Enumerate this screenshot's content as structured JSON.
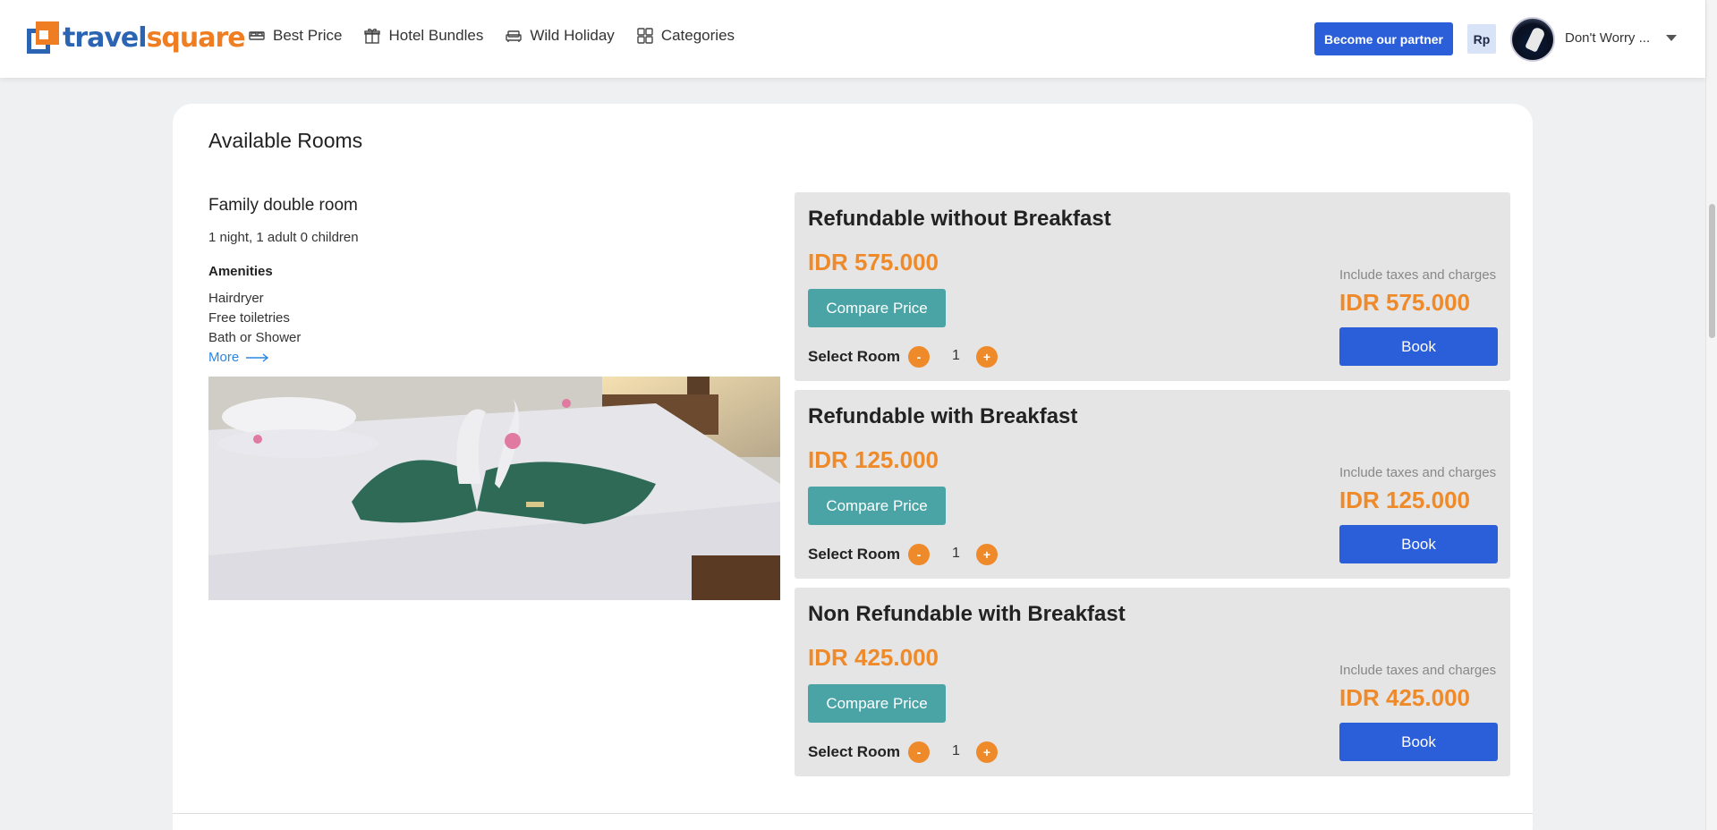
{
  "header": {
    "logo": {
      "part1": "travel",
      "part2": "square"
    },
    "nav": [
      {
        "label": "Best Price",
        "icon": "bed-icon"
      },
      {
        "label": "Hotel Bundles",
        "icon": "gift-icon"
      },
      {
        "label": "Wild Holiday",
        "icon": "sofa-icon"
      },
      {
        "label": "Categories",
        "icon": "grid-icon"
      }
    ],
    "partner_button": "Become our partner",
    "currency": "Rp",
    "user_name": "Don't Worry ..."
  },
  "section": {
    "title": "Available Rooms"
  },
  "room": {
    "name": "Family double room",
    "guests": "1 night, 1 adult 0 children",
    "amenities_title": "Amenities",
    "amenities": [
      "Hairdryer",
      "Free toiletries",
      "Bath or Shower"
    ],
    "more_label": "More"
  },
  "options": [
    {
      "title": "Refundable without Breakfast",
      "price": "IDR 575.000",
      "compare_label": "Compare Price",
      "select_label": "Select Room",
      "minus": "-",
      "quantity": "1",
      "plus": "+",
      "tax_note": "Include taxes and charges",
      "total": "IDR 575.000",
      "book_label": "Book"
    },
    {
      "title": "Refundable with Breakfast",
      "price": "IDR 125.000",
      "compare_label": "Compare Price",
      "select_label": "Select Room",
      "minus": "-",
      "quantity": "1",
      "plus": "+",
      "tax_note": "Include taxes and charges",
      "total": "IDR 125.000",
      "book_label": "Book"
    },
    {
      "title": "Non Refundable with Breakfast",
      "price": "IDR 425.000",
      "compare_label": "Compare Price",
      "select_label": "Select Room",
      "minus": "-",
      "quantity": "1",
      "plus": "+",
      "tax_note": "Include taxes and charges",
      "total": "IDR 425.000",
      "book_label": "Book"
    }
  ],
  "colors": {
    "brand_blue": "#2a64b2",
    "brand_orange": "#ef7d22",
    "price_orange": "#ef8a2a",
    "book_blue": "#2b5fd9",
    "compare_teal": "#4aa3a5"
  }
}
